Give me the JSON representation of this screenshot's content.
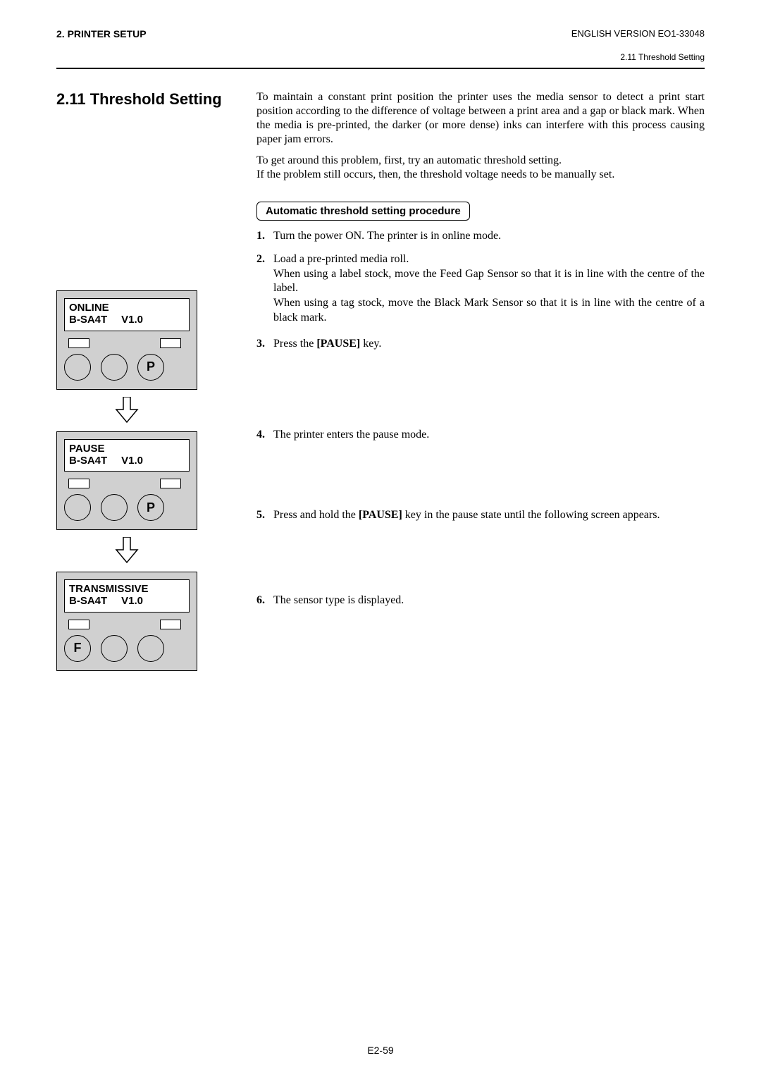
{
  "header": {
    "left": "2. PRINTER SETUP",
    "right": "ENGLISH VERSION EO1-33048",
    "sub": "2.11 Threshold Setting"
  },
  "section": {
    "title": "2.11  Threshold Setting",
    "p1": "To maintain a constant print position the printer uses the media sensor to detect a print start position according to the difference of voltage between a print area and a gap or black mark.  When the media is pre-printed, the darker (or more dense) inks can interfere with this process causing paper jam errors.",
    "p2a": "To get around this problem, first, try an automatic threshold setting.",
    "p2b": "If the problem still occurs, then, the threshold voltage needs to be manually set.",
    "proc_label": "Automatic threshold setting procedure"
  },
  "steps": {
    "s1": {
      "n": "1.",
      "t": "Turn the power ON.  The printer is in online mode."
    },
    "s2": {
      "n": "2.",
      "t": "Load a pre-printed media roll.",
      "sub1": "When using a label stock, move the Feed Gap Sensor so that it is in line with the centre of the label.",
      "sub2": "When using a tag stock, move the Black Mark Sensor so that it is in line with the centre of a black mark."
    },
    "s3": {
      "n": "3.",
      "pre": "Press the ",
      "bold": "[PAUSE]",
      "post": " key."
    },
    "s4": {
      "n": "4.",
      "t": "The printer enters the pause mode."
    },
    "s5": {
      "n": "5.",
      "pre": "Press and hold the ",
      "bold": "[PAUSE]",
      "post": " key in the pause state until the following screen appears."
    },
    "s6": {
      "n": "6.",
      "t": "The sensor type is displayed."
    }
  },
  "panels": {
    "p1": {
      "line1": "ONLINE",
      "line2a": "B-SA4T",
      "line2b": "V1.0",
      "btn3": "P"
    },
    "p2": {
      "line1": "PAUSE",
      "line2a": "B-SA4T",
      "line2b": "V1.0",
      "btn3": "P"
    },
    "p3": {
      "line1": "TRANSMISSIVE",
      "line2a": "B-SA4T",
      "line2b": "V1.0",
      "btn1": "F"
    }
  },
  "footer": {
    "page": "E2-59"
  },
  "period": "."
}
